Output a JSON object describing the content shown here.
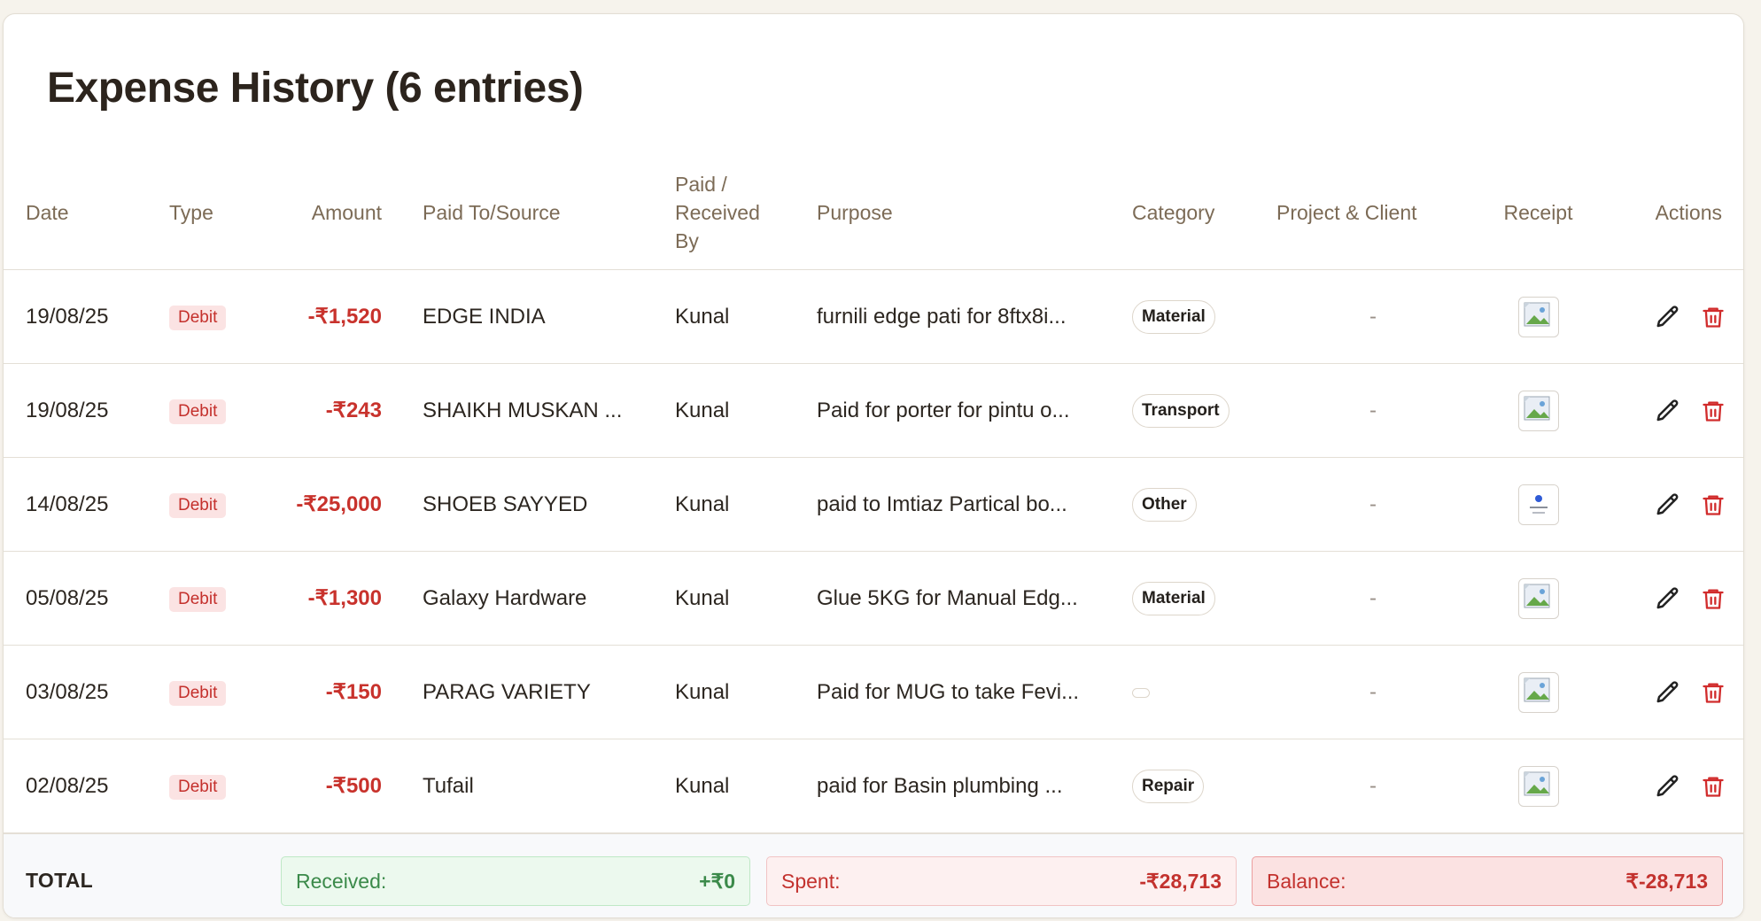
{
  "title": "Expense History (6 entries)",
  "columns": {
    "date": "Date",
    "type": "Type",
    "amount": "Amount",
    "paid_to": "Paid To/Source",
    "paid_by_1": "Paid /",
    "paid_by_2": "Received",
    "paid_by_3": "By",
    "purpose": "Purpose",
    "category": "Category",
    "project": "Project & Client",
    "receipt": "Receipt",
    "actions": "Actions"
  },
  "rows": [
    {
      "date": "19/08/25",
      "type": "Debit",
      "amount": "-₹1,520",
      "paid_to": "EDGE INDIA",
      "paid_by": "Kunal",
      "purpose": "furnili edge pati for 8ftx8i...",
      "category": "Material",
      "project": "-",
      "receipt": "image"
    },
    {
      "date": "19/08/25",
      "type": "Debit",
      "amount": "-₹243",
      "paid_to": "SHAIKH MUSKAN ...",
      "paid_by": "Kunal",
      "purpose": "Paid for porter for pintu o...",
      "category": "Transport",
      "project": "-",
      "receipt": "image"
    },
    {
      "date": "14/08/25",
      "type": "Debit",
      "amount": "-₹25,000",
      "paid_to": "SHOEB SAYYED",
      "paid_by": "Kunal",
      "purpose": "paid to Imtiaz Partical bo...",
      "category": "Other",
      "project": "-",
      "receipt": "document"
    },
    {
      "date": "05/08/25",
      "type": "Debit",
      "amount": "-₹1,300",
      "paid_to": "Galaxy Hardware",
      "paid_by": "Kunal",
      "purpose": "Glue 5KG for Manual Edg...",
      "category": "Material",
      "project": "-",
      "receipt": "image"
    },
    {
      "date": "03/08/25",
      "type": "Debit",
      "amount": "-₹150",
      "paid_to": "PARAG VARIETY",
      "paid_by": "Kunal",
      "purpose": "Paid for MUG to take Fevi...",
      "category": "",
      "project": "-",
      "receipt": "image"
    },
    {
      "date": "02/08/25",
      "type": "Debit",
      "amount": "-₹500",
      "paid_to": "Tufail",
      "paid_by": "Kunal",
      "purpose": "paid for Basin plumbing ...",
      "category": "Repair",
      "project": "-",
      "receipt": "image"
    }
  ],
  "footer": {
    "total_label": "TOTAL",
    "received_label": "Received:",
    "received_value": "+₹0",
    "spent_label": "Spent:",
    "spent_value": "-₹28,713",
    "balance_label": "Balance:",
    "balance_value": "₹-28,713"
  },
  "colors": {
    "debit": "#c8322c",
    "received": "#3b8a4a",
    "accent_header": "#7c6b56"
  },
  "icons": {
    "edit": "pencil-icon",
    "delete": "trash-icon",
    "receipt_image": "broken-image-icon",
    "receipt_document": "document-thumbnail-icon"
  }
}
